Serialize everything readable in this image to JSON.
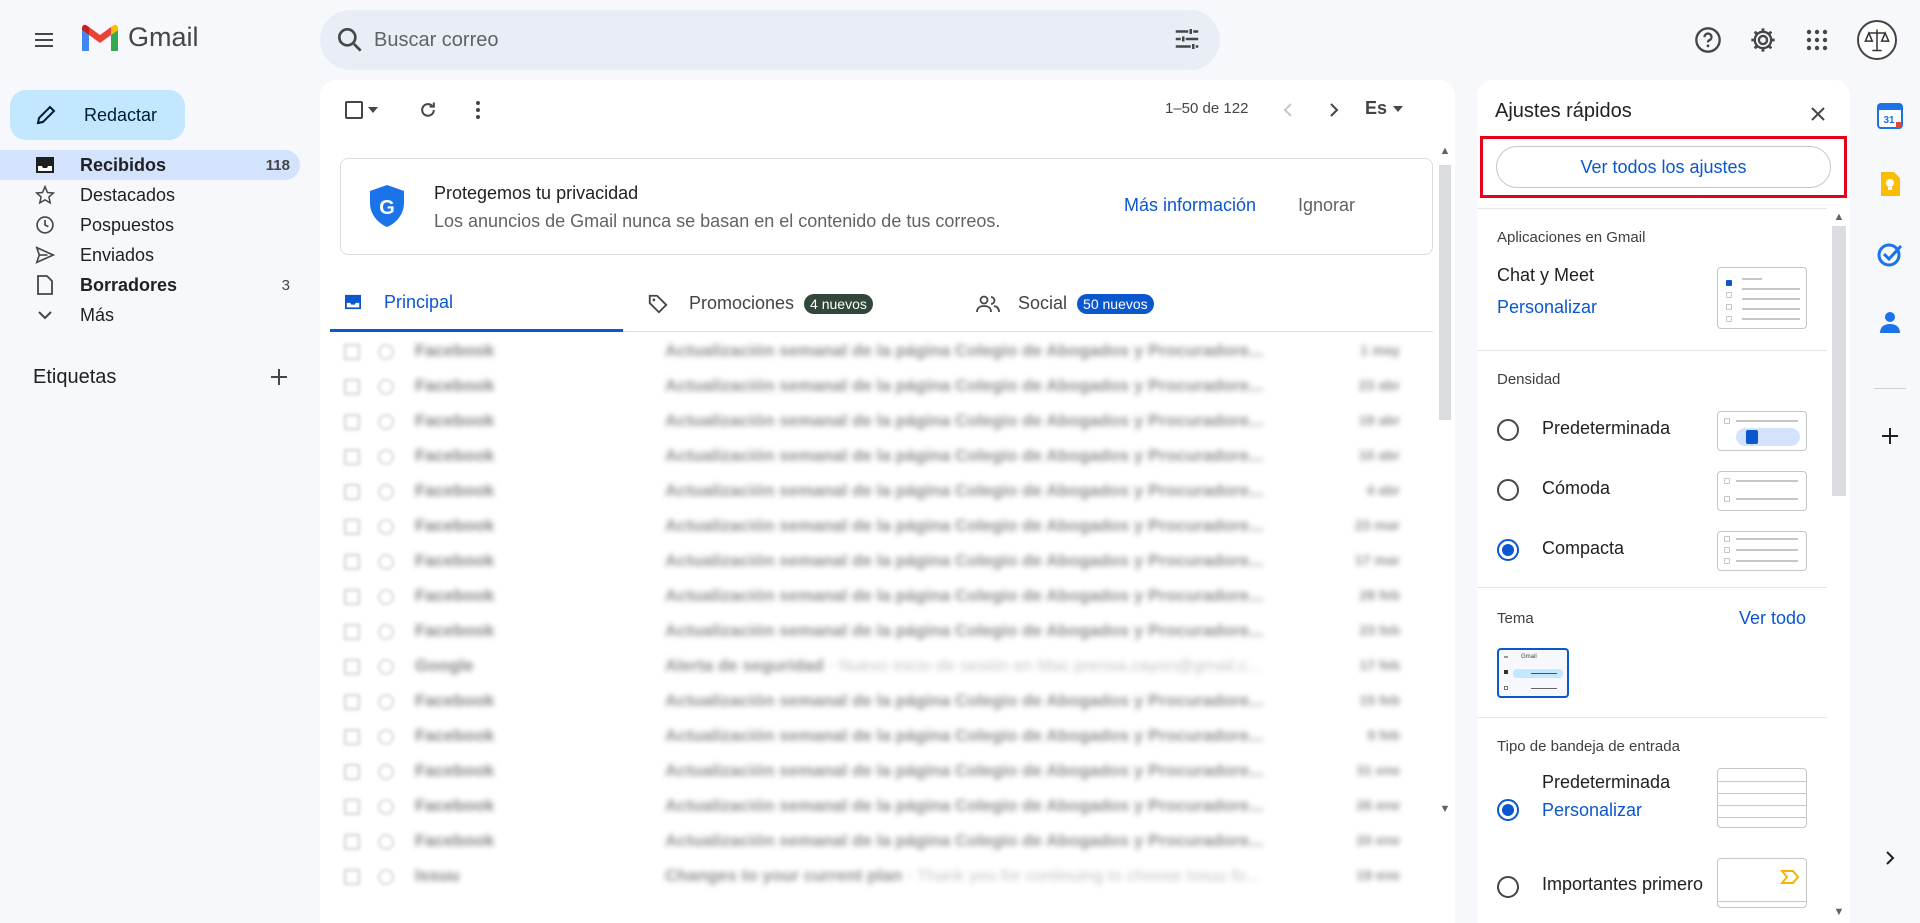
{
  "header": {
    "app_name": "Gmail",
    "search_placeholder": "Buscar correo"
  },
  "sidebar": {
    "compose_label": "Redactar",
    "items": [
      {
        "label": "Recibidos",
        "count": "118",
        "icon": "inbox-icon",
        "active": true,
        "bold": true
      },
      {
        "label": "Destacados",
        "count": "",
        "icon": "star-icon"
      },
      {
        "label": "Pospuestos",
        "count": "",
        "icon": "clock-icon"
      },
      {
        "label": "Enviados",
        "count": "",
        "icon": "send-icon"
      },
      {
        "label": "Borradores",
        "count": "3",
        "icon": "draft-icon",
        "bold": true
      },
      {
        "label": "Más",
        "count": "",
        "icon": "chevron-down-icon"
      }
    ],
    "labels_title": "Etiquetas"
  },
  "toolbar": {
    "pager": "1–50 de 122",
    "input_tool": "Es"
  },
  "privacy_banner": {
    "title": "Protegemos tu privacidad",
    "text": "Los anuncios de Gmail nunca se basan en el contenido de tus correos.",
    "more_link": "Más información",
    "ignore": "Ignorar"
  },
  "tabs": [
    {
      "label": "Principal",
      "badge": "",
      "icon": "inbox-icon",
      "active": true
    },
    {
      "label": "Promociones",
      "badge": "4 nuevos",
      "badge_color": "#188038",
      "icon": "tag-icon"
    },
    {
      "label": "Social",
      "badge": "50 nuevos",
      "badge_color": "#0b57d0",
      "icon": "people-icon"
    }
  ],
  "emails": [
    {
      "sender": "Facebook",
      "subject": "Actualización semanal de la página Colegio de Abogados y Procuradore...",
      "snippet": "",
      "date": "1 may"
    },
    {
      "sender": "Facebook",
      "subject": "Actualización semanal de la página Colegio de Abogados y Procuradore...",
      "snippet": "",
      "date": "23 abr"
    },
    {
      "sender": "Facebook",
      "subject": "Actualización semanal de la página Colegio de Abogados y Procuradore...",
      "snippet": "",
      "date": "19 abr"
    },
    {
      "sender": "Facebook",
      "subject": "Actualización semanal de la página Colegio de Abogados y Procuradore...",
      "snippet": "",
      "date": "10 abr"
    },
    {
      "sender": "Facebook",
      "subject": "Actualización semanal de la página Colegio de Abogados y Procuradore...",
      "snippet": "",
      "date": "4 abr"
    },
    {
      "sender": "Facebook",
      "subject": "Actualización semanal de la página Colegio de Abogados y Procuradore...",
      "snippet": "",
      "date": "23 mar"
    },
    {
      "sender": "Facebook",
      "subject": "Actualización semanal de la página Colegio de Abogados y Procuradore...",
      "snippet": "",
      "date": "17 mar"
    },
    {
      "sender": "Facebook",
      "subject": "Actualización semanal de la página Colegio de Abogados y Procuradore...",
      "snippet": "",
      "date": "28 feb"
    },
    {
      "sender": "Facebook",
      "subject": "Actualización semanal de la página Colegio de Abogados y Procuradore...",
      "snippet": "",
      "date": "23 feb"
    },
    {
      "sender": "Google",
      "subject": "Alerta de seguridad",
      "snippet": " - Nuevo inicio de sesión en Mac prensa.cayon@gmail.c...",
      "date": "17 feb"
    },
    {
      "sender": "Facebook",
      "subject": "Actualización semanal de la página Colegio de Abogados y Procuradore...",
      "snippet": "",
      "date": "15 feb"
    },
    {
      "sender": "Facebook",
      "subject": "Actualización semanal de la página Colegio de Abogados y Procuradore...",
      "snippet": "",
      "date": "9 feb"
    },
    {
      "sender": "Facebook",
      "subject": "Actualización semanal de la página Colegio de Abogados y Procuradore...",
      "snippet": "",
      "date": "31 ene"
    },
    {
      "sender": "Facebook",
      "subject": "Actualización semanal de la página Colegio de Abogados y Procuradore...",
      "snippet": "",
      "date": "26 ene"
    },
    {
      "sender": "Facebook",
      "subject": "Actualización semanal de la página Colegio de Abogados y Procuradore...",
      "snippet": "",
      "date": "20 ene"
    },
    {
      "sender": "Issuu",
      "subject": "Changes to your current plan",
      "snippet": " - Thank you for continuing to choose Issuu fo...",
      "date": "19 ene"
    }
  ],
  "quick_settings": {
    "title": "Ajustes rápidos",
    "see_all": "Ver todos los ajustes",
    "apps_header": "Aplicaciones en Gmail",
    "chat_meet": "Chat y Meet",
    "customize": "Personalizar",
    "density_header": "Densidad",
    "density_options": [
      {
        "label": "Predeterminada",
        "selected": false
      },
      {
        "label": "Cómoda",
        "selected": false
      },
      {
        "label": "Compacta",
        "selected": true
      }
    ],
    "theme_header": "Tema",
    "theme_see_all": "Ver todo",
    "theme_logo_text": "Gmail",
    "inbox_type_header": "Tipo de bandeja de entrada",
    "inbox_default": "Predeterminada",
    "inbox_customize": "Personalizar",
    "inbox_important": "Importantes primero"
  },
  "side_apps": {
    "calendar_day": "31"
  },
  "colors": {
    "accent": "#0b57d0",
    "compose_bg": "#c2e7ff",
    "active_nav": "#d3e3fd",
    "highlight_border": "#e8001c"
  }
}
